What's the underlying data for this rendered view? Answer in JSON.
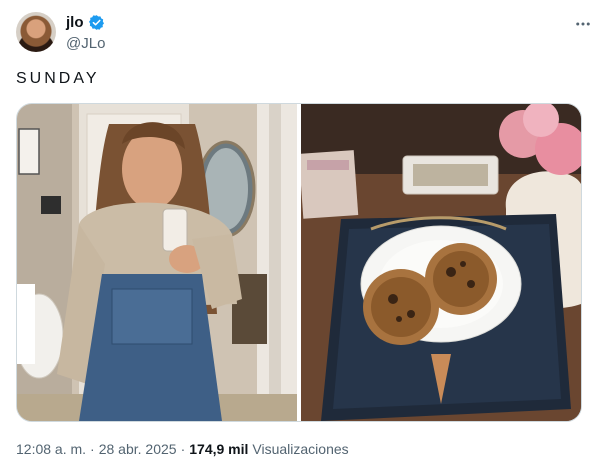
{
  "author": {
    "display_name": "jlo",
    "handle": "@JLo",
    "verified_color": "#1d9bf0"
  },
  "tweet": {
    "text": "SUNDAY"
  },
  "media": [
    {
      "icon": "selfie-photo"
    },
    {
      "icon": "cookies-photo"
    }
  ],
  "footer": {
    "time": "12:08 a. m.",
    "separator": "·",
    "date": "28 abr. 2025",
    "views_count": "174,9 mil",
    "views_label": "Visualizaciones"
  }
}
